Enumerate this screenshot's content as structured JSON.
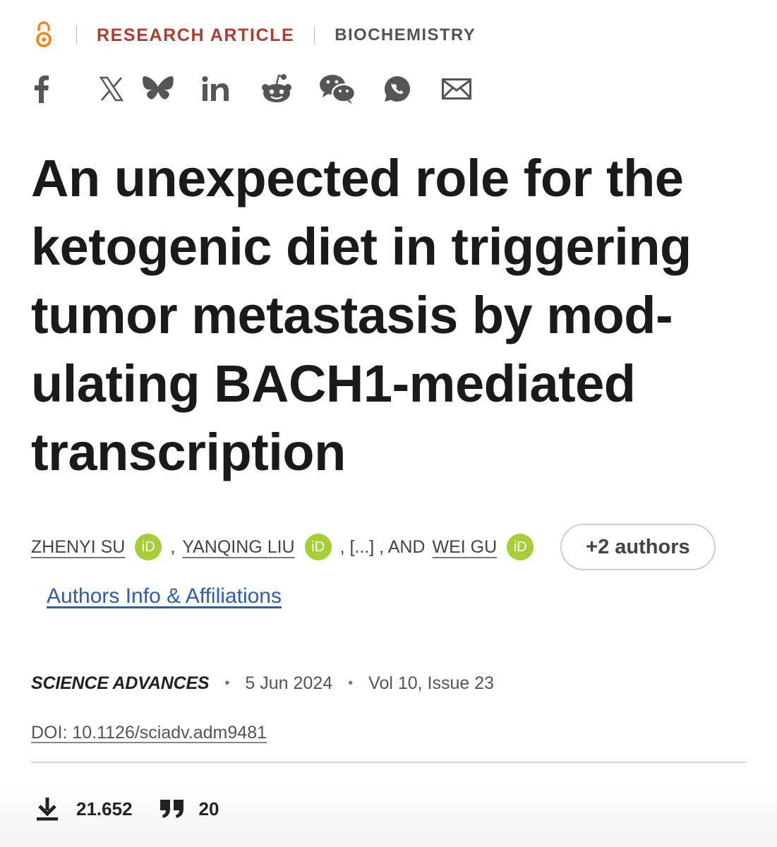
{
  "header": {
    "open_access_icon": "open-access-icon",
    "article_type": "RESEARCH ARTICLE",
    "subject": "BIOCHEMISTRY"
  },
  "share_icons": [
    "facebook-icon",
    "x-icon",
    "bluesky-icon",
    "linkedin-icon",
    "reddit-icon",
    "wechat-icon",
    "whatsapp-icon",
    "email-icon"
  ],
  "article": {
    "title": "An unexpected role for the ketogenic diet in triggering tumor metastasis by mod-ulating BACH1-mediated transcription",
    "authors": [
      {
        "name": "ZHENYI SU"
      },
      {
        "name": "YANQING LIU"
      },
      {
        "name": "WEI GU"
      }
    ],
    "separator_1": ",",
    "ellipsis": ", [...] , AND",
    "more_authors": "+2 authors",
    "affiliations_link": "Authors Info & Affiliations",
    "orcid_label": "iD",
    "journal": "SCIENCE ADVANCES",
    "date": "5 Jun 2024",
    "volume_issue": "Vol 10, Issue 23",
    "bullet": "•",
    "doi": "DOI: 10.1126/sciadv.adm9481"
  },
  "metrics": {
    "downloads": "21.652",
    "citations": "20"
  },
  "colors": {
    "accent_red": "#b53a2c",
    "orcid_green": "#a6ce39",
    "link_blue": "#2a5db8",
    "open_access_orange": "#f68212"
  }
}
